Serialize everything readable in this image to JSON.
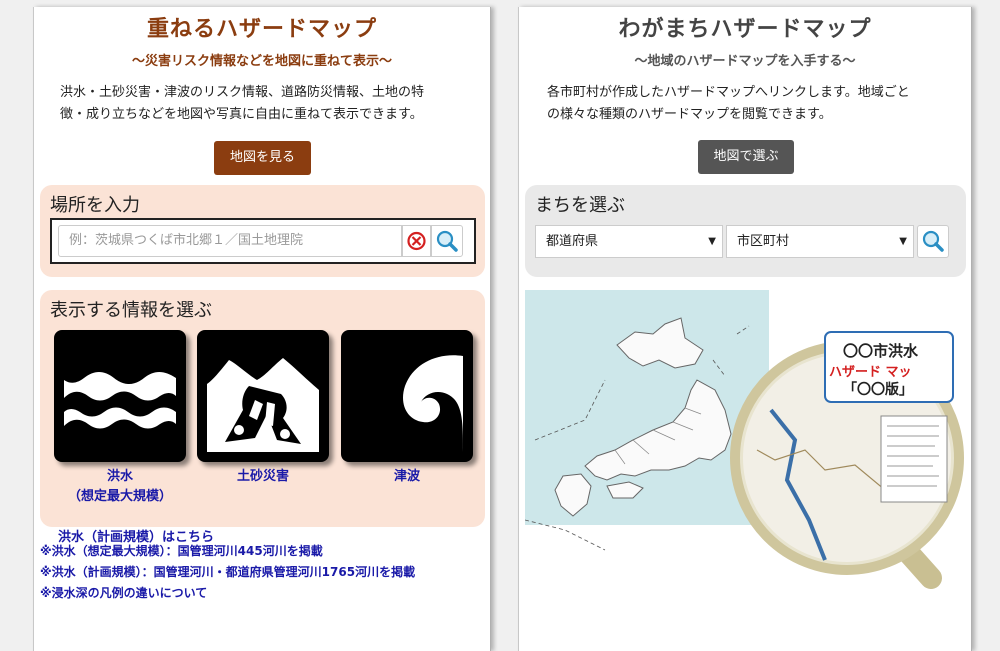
{
  "left_panel": {
    "title": "重ねるハザードマップ",
    "subtitle": "～災害リスク情報などを地図に重ねて表示～",
    "description_line1": "洪水・土砂災害・津波のリスク情報、道路防災情報、土地の特",
    "description_line2": "徴・成り立ちなどを地図や写真に自由に重ねて表示できます。",
    "map_button": "地図を見る",
    "search": {
      "title": "場所を入力",
      "placeholder": "例：茨城県つくば市北郷１／国土地理院"
    },
    "info": {
      "title": "表示する情報を選ぶ",
      "tiles": [
        {
          "icon": "flood-icon",
          "label_line1": "洪水",
          "label_line2": "（想定最大規模）"
        },
        {
          "icon": "landslide-icon",
          "label_line1": "土砂災害",
          "label_line2": ""
        },
        {
          "icon": "tsunami-icon",
          "label_line1": "津波",
          "label_line2": ""
        }
      ]
    },
    "links": [
      "洪水（計画規模）はこちら",
      "※洪水（想定最大規模）：国管理河川445河川を掲載",
      "※洪水（計画規模）：国管理河川・都道府県管理河川1765河川を掲載",
      "※浸水深の凡例の違いについて"
    ]
  },
  "right_panel": {
    "title": "わがまちハザードマップ",
    "subtitle": "～地域のハザードマップを入手する～",
    "description_line1": "各市町村が作成したハザードマップへリンクします。地域ごと",
    "description_line2": "の様々な種類のハザードマップを閲覧できます。",
    "map_button": "地図で選ぶ",
    "town": {
      "title": "まちを選ぶ",
      "prefecture": "都道府県",
      "city": "市区町村"
    },
    "magnifier": {
      "line1": "〇〇市洪水",
      "line2": "ハザード マッ",
      "line3": "「〇〇版」"
    }
  },
  "colors": {
    "left_accent": "#8b3d10",
    "right_accent": "#555555",
    "left_box_bg": "#fbe3d6",
    "right_box_bg": "#e9e9e9",
    "link": "#1a1aa8"
  }
}
